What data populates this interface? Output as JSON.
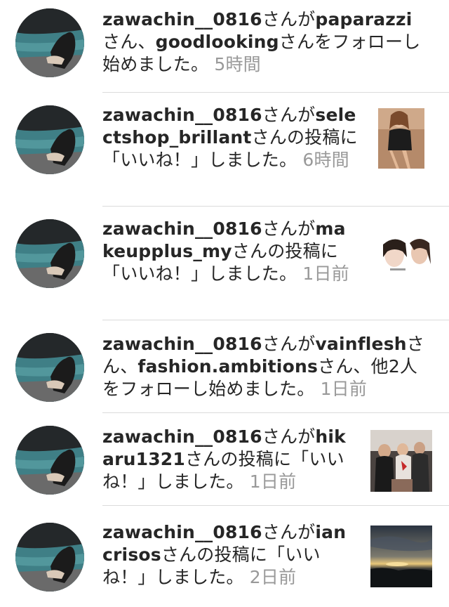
{
  "items": [
    {
      "actor": "zawachin__0816",
      "parts": [
        {
          "t": "さんが",
          "k": "plain"
        },
        {
          "t": "paparazzi",
          "k": "user"
        },
        {
          "t": "さん、",
          "k": "plain"
        },
        {
          "t": "goodlooking",
          "k": "user"
        },
        {
          "t": "さんをフォローし始めました。",
          "k": "plain"
        },
        {
          "t": "5時間",
          "k": "time"
        }
      ],
      "thumbnail": null
    },
    {
      "actor": "zawachin__0816",
      "parts": [
        {
          "t": "さんが",
          "k": "plain"
        },
        {
          "t": "selectshop_brillant",
          "k": "user"
        },
        {
          "t": "さんの投稿に「いいね！」しました。",
          "k": "plain"
        },
        {
          "t": "6時間",
          "k": "time"
        }
      ],
      "thumbnail": "photo of woman in lingerie-style outfit"
    },
    {
      "actor": "zawachin__0816",
      "parts": [
        {
          "t": "さんが",
          "k": "plain"
        },
        {
          "t": "makeupplus_my",
          "k": "user"
        },
        {
          "t": "さんの投稿に「いいね！」しました。",
          "k": "plain"
        },
        {
          "t": "1日前",
          "k": "time"
        }
      ],
      "thumbnail": "makeup comparison photo"
    },
    {
      "actor": "zawachin__0816",
      "parts": [
        {
          "t": "さんが",
          "k": "plain"
        },
        {
          "t": "vainflesh",
          "k": "user"
        },
        {
          "t": "さん、",
          "k": "plain"
        },
        {
          "t": "fashion.ambitions",
          "k": "user"
        },
        {
          "t": "さん、他2人をフォローし始めました。",
          "k": "plain"
        },
        {
          "t": "1日前",
          "k": "time"
        }
      ],
      "thumbnail": null
    },
    {
      "actor": "zawachin__0816",
      "parts": [
        {
          "t": "さんが",
          "k": "plain"
        },
        {
          "t": "hikaru1321",
          "k": "user"
        },
        {
          "t": "さんの投稿に「いいね！」しました。",
          "k": "plain"
        },
        {
          "t": "1日前",
          "k": "time"
        }
      ],
      "thumbnail": "group photo of people"
    },
    {
      "actor": "zawachin__0816",
      "parts": [
        {
          "t": "さんが",
          "k": "plain"
        },
        {
          "t": "iancrisos",
          "k": "user"
        },
        {
          "t": "さんの投稿に「いいね！」しました。",
          "k": "plain"
        },
        {
          "t": "2日前",
          "k": "time"
        }
      ],
      "thumbnail": "sunset over sea photo"
    }
  ],
  "colors": {
    "text": "#262626",
    "username": "#262626",
    "timestamp": "#999999",
    "divider": "#dbdbdb",
    "background": "#ffffff"
  }
}
